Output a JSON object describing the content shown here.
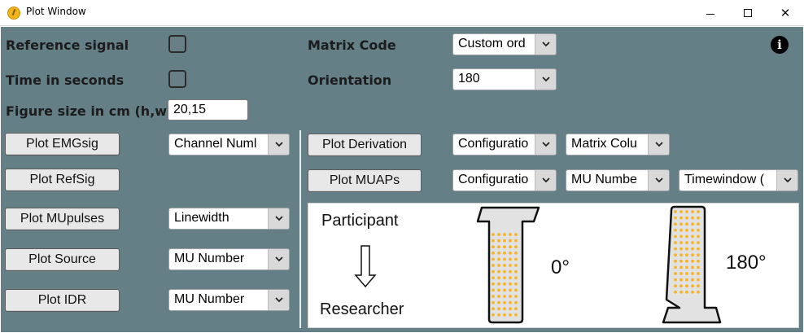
{
  "window": {
    "title": "Plot Window",
    "minimize_glyph": "",
    "maximize_glyph": "",
    "close_glyph": "✕"
  },
  "left_settings": {
    "reference_signal_label": "Reference signal",
    "time_in_seconds_label": "Time in seconds",
    "figure_size_label": "Figure size in cm (h,w)",
    "figure_size_value": "20,15"
  },
  "right_settings": {
    "matrix_code_label": "Matrix Code",
    "matrix_code_value": "Custom ord",
    "orientation_label": "Orientation",
    "orientation_value": "180",
    "info_glyph": "i"
  },
  "left_plots": [
    {
      "button": "Plot EMGsig",
      "option": "Channel Numl"
    },
    {
      "button": "Plot RefSig",
      "option": ""
    },
    {
      "button": "Plot MUpulses",
      "option": "Linewidth"
    },
    {
      "button": "Plot Source",
      "option": "MU Number"
    },
    {
      "button": "Plot IDR",
      "option": "MU Number"
    }
  ],
  "right_plots": {
    "derivation_button": "Plot Derivation",
    "derivation_config": "Configuratio",
    "derivation_column": "Matrix Colu",
    "muaps_button": "Plot MUAPs",
    "muaps_config": "Configuratio",
    "muaps_mu_number": "MU Numbe",
    "muaps_timewindow": "Timewindow ("
  },
  "diagram": {
    "participant_label": "Participant",
    "researcher_label": "Researcher",
    "angle_0_label": "0°",
    "angle_180_label": "180°",
    "electrode_color": "#f5b52a"
  },
  "colors": {
    "background": "#657f87",
    "button_face": "#e8e8e8",
    "divider": "#e7ecee"
  }
}
